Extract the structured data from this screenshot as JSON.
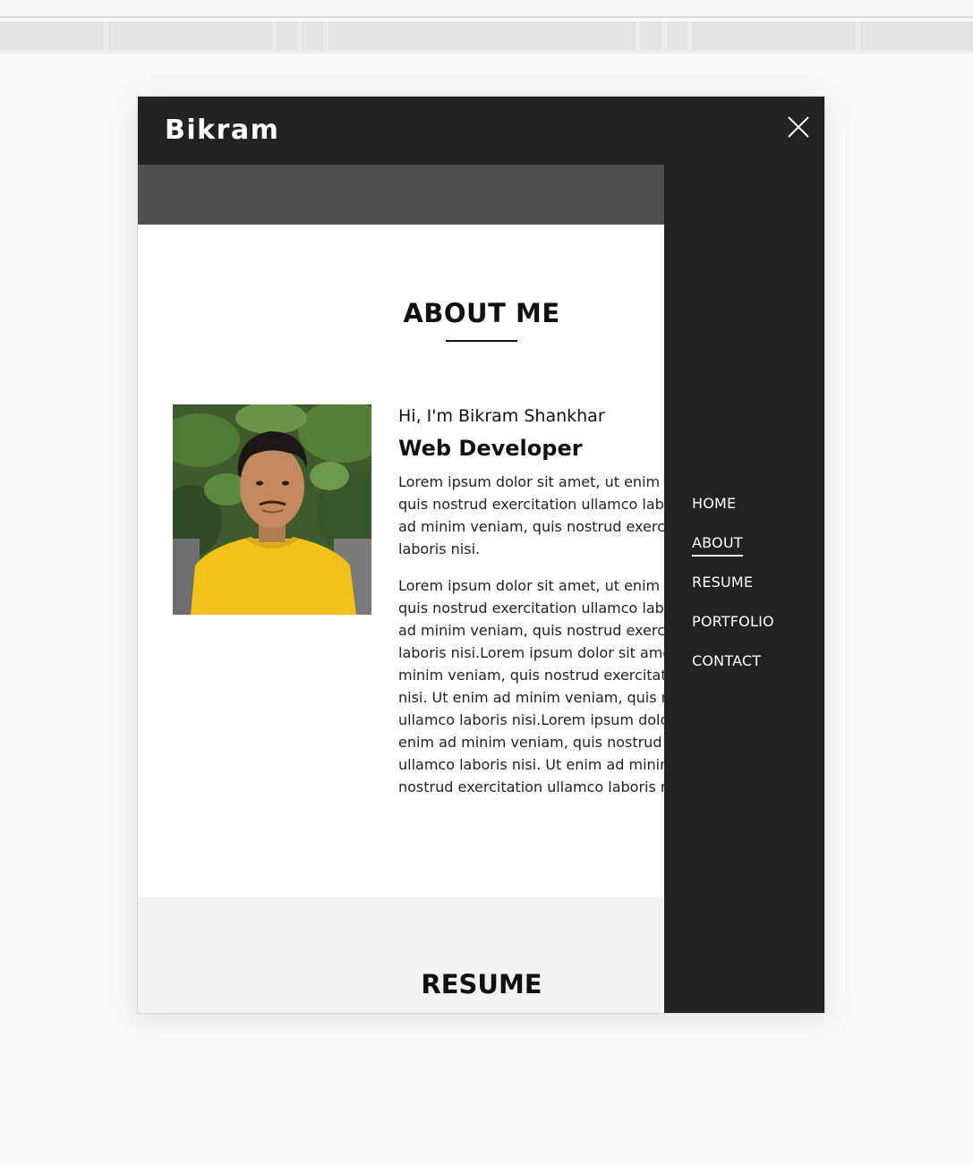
{
  "site": {
    "brand": "Bikram"
  },
  "about": {
    "title": "ABOUT ME",
    "greeting": "Hi, I'm Bikram Shankhar",
    "role": "Web Developer",
    "paragraph1": [
      "Lorem ipsum dolor sit amet, ut enim a",
      "quis nostrud exercitation ullamco labo",
      "ad minim veniam, quis nostrud exercit",
      "laboris nisi."
    ],
    "paragraph2": [
      "Lorem ipsum dolor sit amet, ut enim a",
      "quis nostrud exercitation ullamco labo",
      "ad minim veniam, quis nostrud exercit",
      "laboris nisi.Lorem ipsum dolor sit ame",
      "minim veniam, quis nostrud exercitatio",
      "nisi. Ut enim ad minim veniam, quis no",
      "ullamco laboris nisi.Lorem ipsum dolo",
      "enim ad minim veniam, quis nostrud e",
      "ullamco laboris nisi. Ut enim ad minim",
      "nostrud exercitation ullamco laboris n"
    ]
  },
  "resume": {
    "title": "RESUME"
  },
  "nav": {
    "items": [
      {
        "label": "HOME"
      },
      {
        "label": "ABOUT",
        "active": true
      },
      {
        "label": "RESUME"
      },
      {
        "label": "PORTFOLIO"
      },
      {
        "label": "CONTACT"
      }
    ]
  },
  "icons": {
    "close": "close-icon",
    "photo": "profile-photo"
  },
  "colors": {
    "header": "#222222",
    "hero_band": "#505050",
    "resume_bg": "#f2f2f2",
    "accent_shirt": "#f2c21b"
  }
}
